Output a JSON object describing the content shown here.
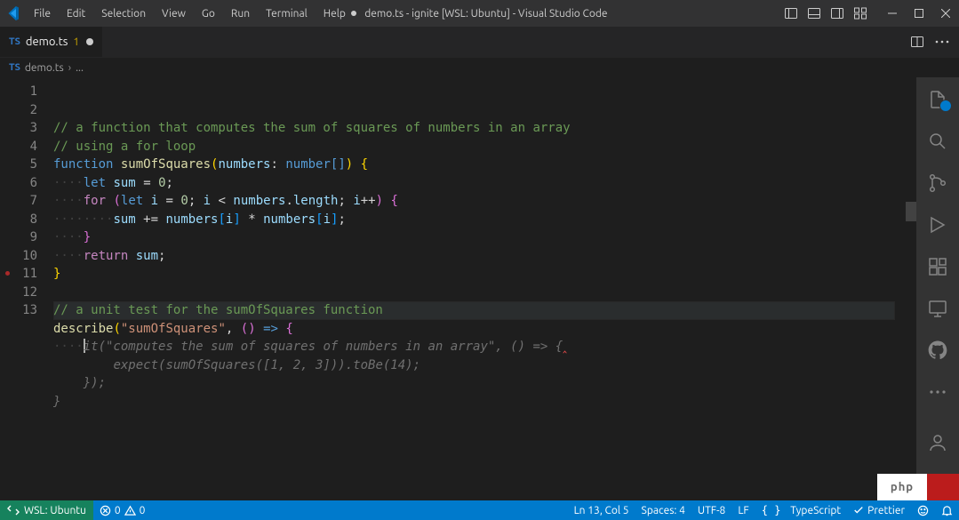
{
  "menu": {
    "items": [
      "File",
      "Edit",
      "Selection",
      "View",
      "Go",
      "Run",
      "Terminal",
      "Help"
    ]
  },
  "title": {
    "dirty": true,
    "filename": "demo.ts",
    "project": "ignite [WSL: Ubuntu]",
    "app": "Visual Studio Code"
  },
  "tab": {
    "language": "TS",
    "name": "demo.ts",
    "problems": "1",
    "dirty": true
  },
  "breadcrumb": {
    "language": "TS",
    "file": "demo.ts",
    "more": "..."
  },
  "line_numbers": {
    "from": 1,
    "to": 13
  },
  "code": {
    "comment1": "// a function that computes the sum of squares of numbers in an array",
    "comment2": "// using a for loop",
    "kw_function": "function",
    "fn_name": "sumOfSquares",
    "p_numbers": "numbers",
    "ty_number": "number",
    "brkts": "[]",
    "kw_let": "let",
    "v_sum": "sum",
    "eq": "=",
    "zero": "0",
    "kw_for": "for",
    "v_i": "i",
    "lt": "<",
    "dot": ".",
    "m_length": "length",
    "inc": "++",
    "peq": "+=",
    "star": "*",
    "kw_return": "return",
    "comment3": "// a unit test for the sumOfSquares function",
    "fn_describe": "describe",
    "str_sos": "\"sumOfSquares\"",
    "arrow": "=>",
    "comma": ",",
    "ghost_l1": "it(\"computes the sum of squares of numbers in an array\", () => {",
    "ghost_l2": "expect(sumOfSquares([1, 2, 3])).toBe(14);",
    "ghost_l3": "});",
    "ghost_l4": "}"
  },
  "status": {
    "remote_label": "WSL: Ubuntu",
    "errors": "0",
    "warnings": "0",
    "ln_col": "Ln 13, Col 5",
    "spaces": "Spaces: 4",
    "encoding": "UTF-8",
    "eol": "LF",
    "lang": "TypeScript",
    "prettier": "Prettier"
  },
  "phpmark": "php",
  "colors": {
    "statusbar": "#007acc",
    "remote": "#16825D"
  }
}
